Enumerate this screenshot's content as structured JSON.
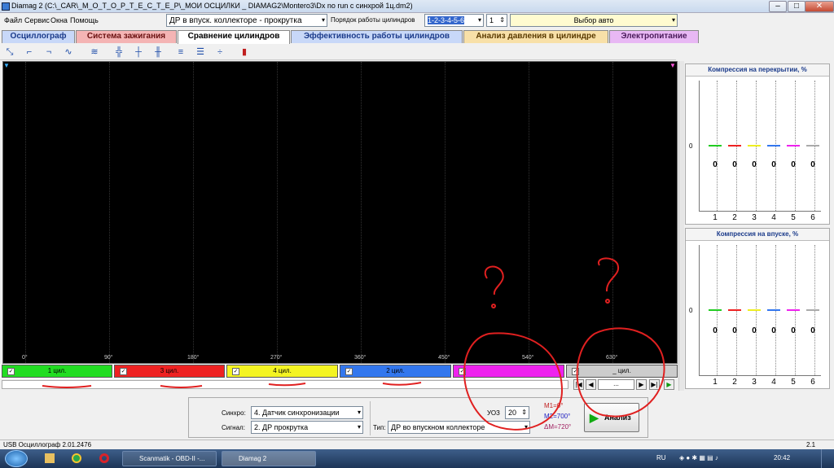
{
  "window": {
    "title": "Diamag 2 (C:\\_CAR\\_М_О_Т_О_Р_Т_Е_С_Т_Е_Р\\_МОИ ОСЦИЛКИ _ DIAMAG2\\Montero3\\Dx no run с синхрой 1ц.dm2)",
    "min": "–",
    "max": "□",
    "close": "✕"
  },
  "menu": {
    "items": [
      "Файл",
      "Сервис",
      "Окна",
      "Помощь"
    ],
    "mode_select": "ДР в впуск. коллекторе - прокрутка",
    "firing_order_label": "Порядок работы цилиндров",
    "firing_order_value": "1-2-3-4-5-6",
    "cyl_value": "1",
    "auto_select": "Выбор авто"
  },
  "tabs": [
    {
      "label": "Осциллограф",
      "color": "#c8d8f8"
    },
    {
      "label": "Система зажигания",
      "color": "#f4b4b4"
    },
    {
      "label": "Сравнение цилиндров",
      "color": "#ffffff"
    },
    {
      "label": "Эффективность работы цилиндров",
      "color": "#c8d8f8"
    },
    {
      "label": "Анализ давления в цилиндре",
      "color": "#f8e0a8"
    },
    {
      "label": "Электропитание",
      "color": "#e8b8f4"
    }
  ],
  "scope": {
    "degree_labels": [
      "0°",
      "90°",
      "180°",
      "270°",
      "360°",
      "450°",
      "540°",
      "630°"
    ]
  },
  "cylinders": [
    {
      "label": "1 цил.",
      "color": "#22dd22"
    },
    {
      "label": "3 цил.",
      "color": "#ee2222"
    },
    {
      "label": "4 цил.",
      "color": "#f4f422"
    },
    {
      "label": "2 цил.",
      "color": "#3377ee"
    },
    {
      "label": "",
      "color": "#ee22ee"
    },
    {
      "label": "_ цил.",
      "color": "#cccccc"
    }
  ],
  "nav": {
    "page": "..."
  },
  "bottom": {
    "sync_label": "Синхро:",
    "sync_value": "4.  Датчик синхронизации",
    "signal_label": "Сигнал:",
    "signal_value": "2.  ДР прокрутка",
    "type_label": "Тип:",
    "type_value": "ДР во впускном коллекторе",
    "uoz_label": "УОЗ",
    "uoz_value": "20",
    "m1": "M1=0°",
    "m2": "M2=700°",
    "dm": "ΔM=720°",
    "analyze": "Анализ"
  },
  "panels": [
    {
      "title": "Компрессия на перекрытии, %",
      "axis": "0",
      "values": [
        "0",
        "0",
        "0",
        "0",
        "0",
        "0"
      ],
      "cols": [
        "1",
        "2",
        "3",
        "4",
        "5",
        "6"
      ]
    },
    {
      "title": "Компрессия на впуске, %",
      "axis": "0",
      "values": [
        "0",
        "0",
        "0",
        "0",
        "0",
        "0"
      ],
      "cols": [
        "1",
        "2",
        "3",
        "4",
        "5",
        "6"
      ]
    }
  ],
  "status": {
    "left": "USB Осциллограф  2.01.2476",
    "right": "2.1"
  },
  "taskbar": {
    "tasks": [
      "Scanmatik - OBD-II -...",
      "Diamag 2"
    ],
    "lang": "RU",
    "time": "20:42"
  },
  "colors": {
    "line1": "#22cc22",
    "line2": "#ee2222",
    "line3": "#eeee22",
    "line4": "#3377ee",
    "line5": "#ee22ee",
    "line6": "#aaaaaa"
  }
}
